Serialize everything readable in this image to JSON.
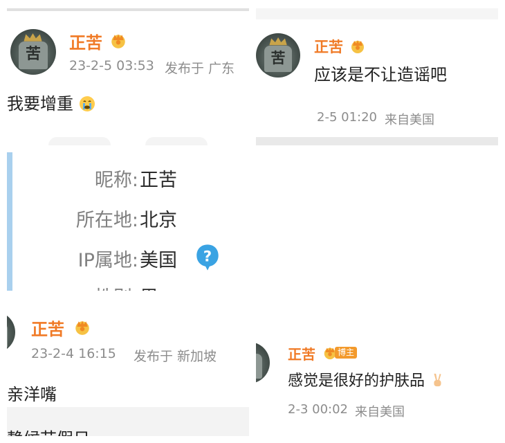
{
  "posts": [
    {
      "username": "正苦",
      "date": "23-2-5 03:53",
      "location": "发布于 广东",
      "text": "我要增重",
      "emoji": "crying-face-icon"
    },
    {
      "username": "正苦",
      "text": "应该是不让造谣吧",
      "date": "2-5 01:20",
      "location": "来自美国"
    },
    {
      "username": "正苦",
      "date": "23-2-4 16:15",
      "location": "发布于 新加坡",
      "text": "亲洋嘴",
      "footer_text": "静候节假日"
    },
    {
      "username": "正苦",
      "badge": "博主",
      "text": "感觉是很好的护肤品",
      "emoji": "victory-hand-icon",
      "date": "2-3 00:02",
      "location": "来自美国"
    }
  ],
  "profile": {
    "fields": [
      {
        "label": "昵称:",
        "value": "正苦"
      },
      {
        "label": "所在地:",
        "value": "北京"
      },
      {
        "label": "IP属地:",
        "value": "美国"
      },
      {
        "label": "性别:",
        "value": "男"
      }
    ],
    "help_icon": "question-mark-icon"
  },
  "colors": {
    "username": "#f07a26",
    "meta": "#8c8c8c",
    "accent_bar": "#a9d0ee",
    "help_icon": "#3aa3e3"
  }
}
